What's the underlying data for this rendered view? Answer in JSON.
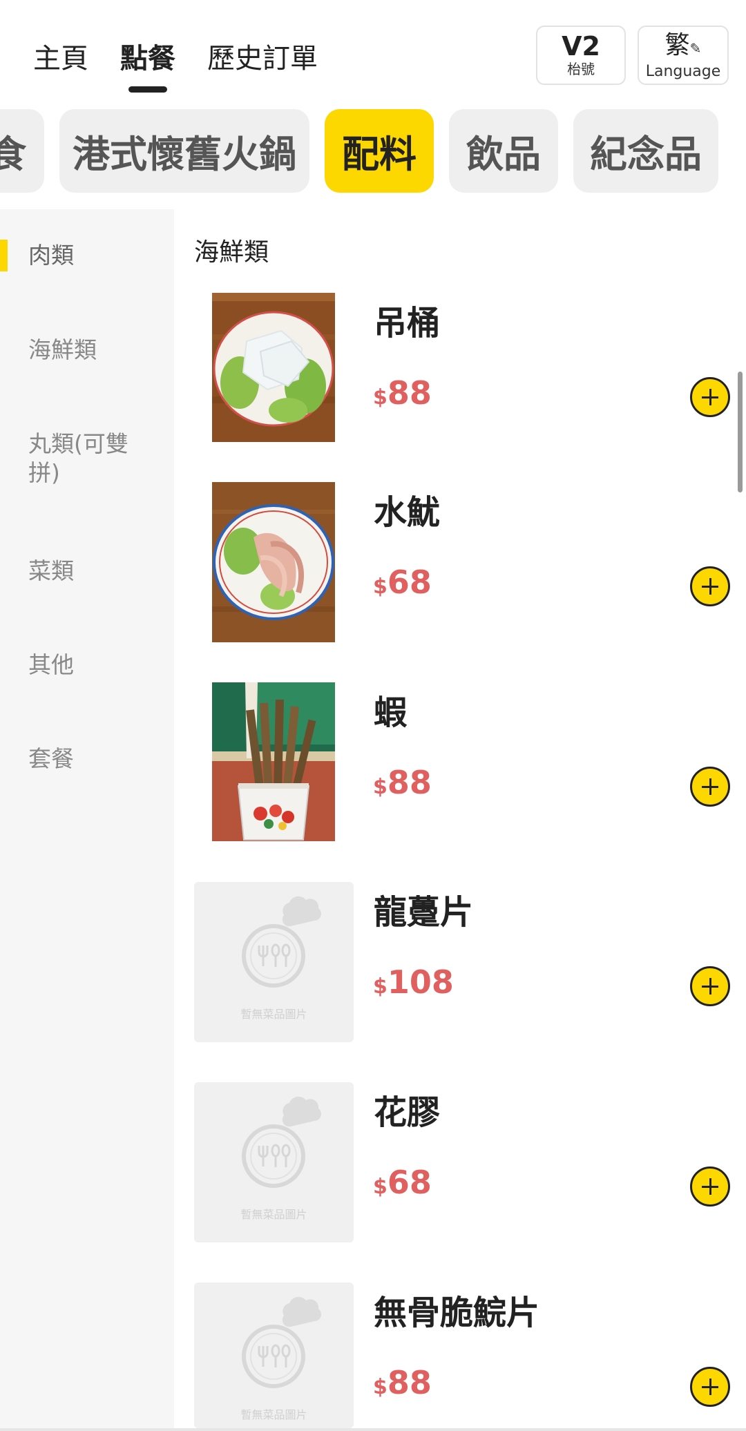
{
  "nav": {
    "tabs": [
      {
        "label": "主頁"
      },
      {
        "label": "點餐",
        "active": true
      },
      {
        "label": "歷史訂單"
      }
    ]
  },
  "table": {
    "number": "V2",
    "label": "枱號"
  },
  "language": {
    "current": "繁",
    "label": "Language"
  },
  "categories": [
    {
      "label": "食"
    },
    {
      "label": "港式懷舊火鍋"
    },
    {
      "label": "配料",
      "active": true
    },
    {
      "label": "飲品"
    },
    {
      "label": "紀念品"
    }
  ],
  "sidebar": {
    "items": [
      {
        "label": "肉類",
        "active": true
      },
      {
        "label": "海鮮類"
      },
      {
        "label": "丸類(可雙拼)"
      },
      {
        "label": "菜類"
      },
      {
        "label": "其他"
      },
      {
        "label": "套餐"
      }
    ]
  },
  "section": {
    "title": "海鮮類"
  },
  "currency_symbol": "$",
  "items": [
    {
      "name": "吊桶",
      "price": "88",
      "image": "squid-tube-dish-photo"
    },
    {
      "name": "水魷",
      "price": "68",
      "image": "soaked-squid-dish-photo"
    },
    {
      "name": "蝦",
      "price": "88",
      "image": "shrimp-cup-photo"
    },
    {
      "name": "龍躉片",
      "price": "108",
      "image": "placeholder"
    },
    {
      "name": "花膠",
      "price": "68",
      "image": "placeholder"
    },
    {
      "name": "無骨脆鯇片",
      "price": "88",
      "image": "placeholder"
    }
  ],
  "placeholder_text": "暫無菜品圖片",
  "colors": {
    "accent": "#fcd800",
    "price": "#e06060",
    "sidebar_bg": "#f6f6f6",
    "pill_bg": "#efefef"
  },
  "icons": {
    "add": "plus-circle-icon",
    "edit": "pencil-icon",
    "placeholder": "chef-hat-plate-icon"
  }
}
